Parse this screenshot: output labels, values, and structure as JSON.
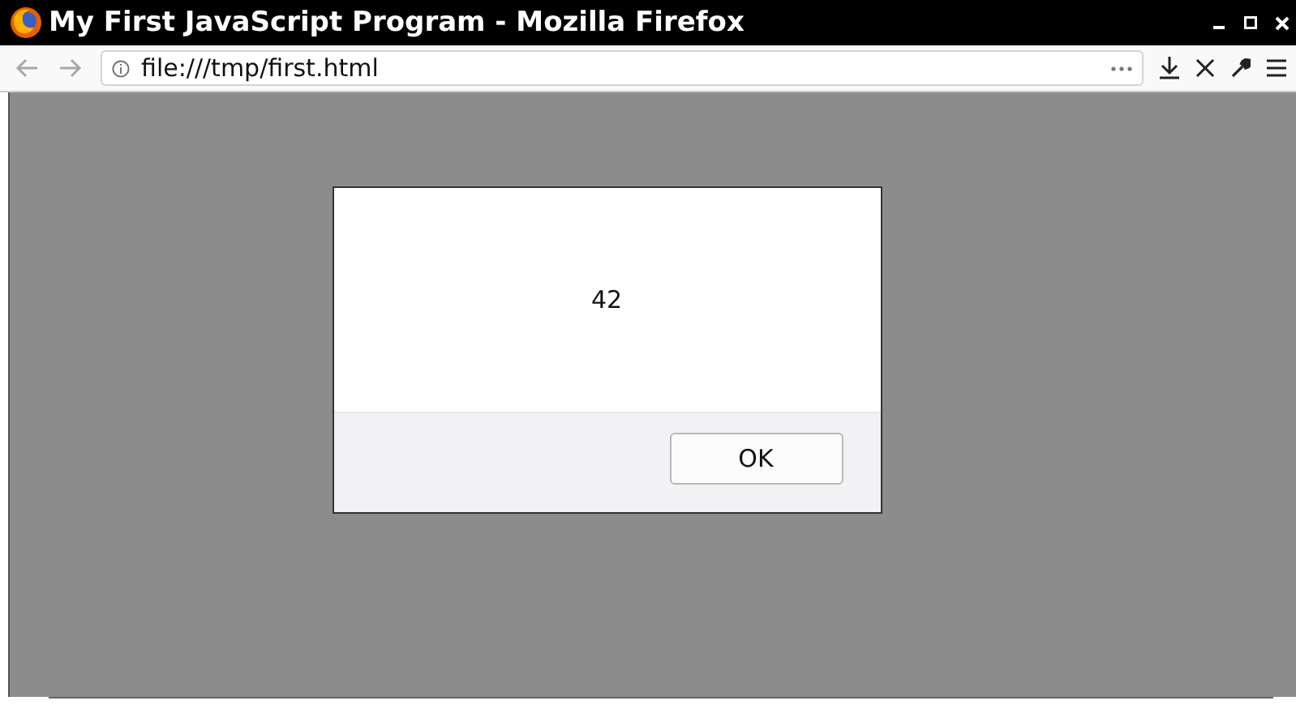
{
  "window": {
    "title": "My First JavaScript Program - Mozilla Firefox"
  },
  "navigation": [
    {
      "kind": "back",
      "disabled": true
    },
    {
      "kind": "forward",
      "disabled": true
    }
  ],
  "address_bar": {
    "url": "file:///tmp/first.html"
  },
  "dialog": {
    "message": "42",
    "buttons": [
      "OK"
    ]
  }
}
